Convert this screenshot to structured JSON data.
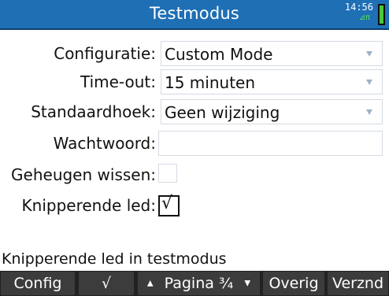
{
  "header": {
    "title": "Testmodus",
    "clock": "14:56",
    "battery_glyph": "⊿π"
  },
  "form": {
    "config_label": "Configuratie:",
    "config_value": "Custom Mode",
    "timeout_label": "Time-out:",
    "timeout_value": "15 minuten",
    "angle_label": "Standaardhoek:",
    "angle_value": "Geen wijziging",
    "password_label": "Wachtwoord:",
    "password_value": "",
    "memory_label": "Geheugen wissen:",
    "memory_checked": false,
    "led_label": "Knipperende led:",
    "led_checked": true,
    "check_glyph": "√"
  },
  "help_text": "Knipperende led in testmodus",
  "menu": {
    "config": "Config",
    "check": "√",
    "page_up_glyph": "▲",
    "page": "Pagina ¾",
    "page_down_glyph": "▼",
    "other": "Overig",
    "send": "Verznd"
  },
  "colors": {
    "titlebar": "#1f6fb5",
    "menubar": "#222222",
    "battery": "#48c93a"
  }
}
